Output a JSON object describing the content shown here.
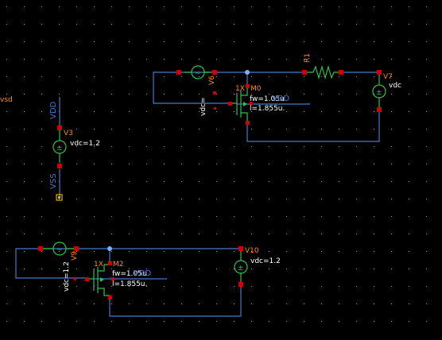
{
  "colors": {
    "background": "#000000",
    "wire": "#4a78c8",
    "pin": "#d00000",
    "symbol": "#2cc44a",
    "instance_label": "#ff8a1c",
    "param_label": "#ffffff",
    "net_label": "#4a78c8"
  },
  "top_circuit": {
    "source_left": {
      "name": "V6",
      "param": "vdc="
    },
    "resistor": {
      "name": "R1"
    },
    "transistor": {
      "name": "M0",
      "multiplier": "1X",
      "fw": "fw=1.05u",
      "length": "l=1.855u."
    },
    "source_right": {
      "name": "V7",
      "param": "vdc"
    }
  },
  "left_circuit": {
    "net_top": "VDD",
    "net_bottom": "VSS",
    "source": {
      "name": "V3",
      "param": "vdc=1.2"
    },
    "offscreen_label": "vsd"
  },
  "bottom_circuit": {
    "source_left": {
      "name": "V9",
      "param": "vdc=1.2"
    },
    "transistor": {
      "name": "M2",
      "multiplier": "1X",
      "fw": "fw=1.05u",
      "length": "l=1.855u."
    },
    "source_right": {
      "name": "V10",
      "param": "vdc=1.2"
    },
    "net_vdd": "VDD"
  }
}
